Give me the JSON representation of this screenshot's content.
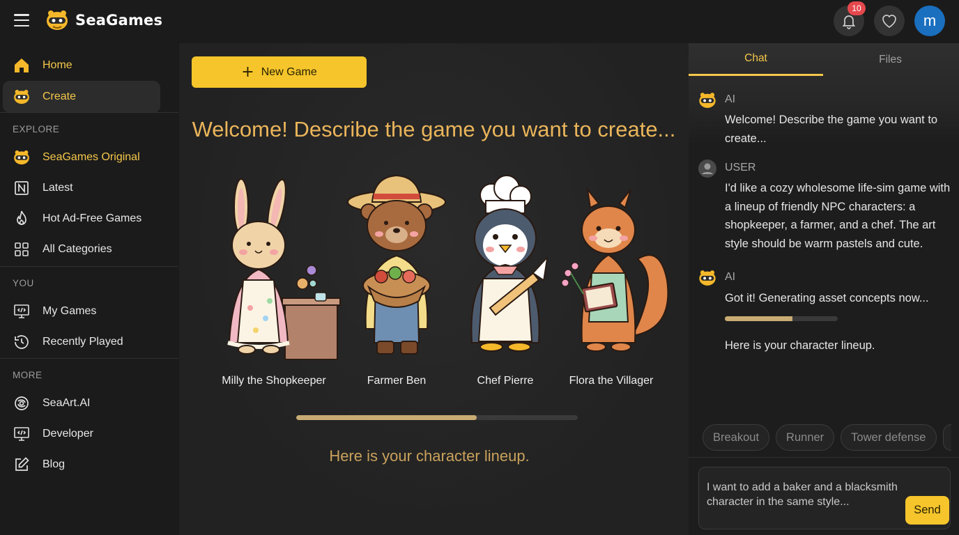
{
  "header": {
    "brand": "SeaGames",
    "notification_count": "10",
    "avatar_letter": "m"
  },
  "sidebar": {
    "items_top": [
      {
        "label": "Home",
        "icon": "home-icon"
      },
      {
        "label": "Create",
        "icon": "seagames-mascot-icon"
      }
    ],
    "explore_label": "EXPLORE",
    "explore_items": [
      {
        "label": "SeaGames Original",
        "icon": "seagames-mascot-icon"
      },
      {
        "label": "Latest",
        "icon": "new-badge-icon"
      },
      {
        "label": "Hot Ad-Free Games",
        "icon": "flame-icon"
      },
      {
        "label": "All Categories",
        "icon": "grid-icon"
      }
    ],
    "you_label": "YOU",
    "you_items": [
      {
        "label": "My Games",
        "icon": "code-monitor-icon"
      },
      {
        "label": "Recently Played",
        "icon": "history-icon"
      }
    ],
    "more_label": "MORE",
    "more_items": [
      {
        "label": "SeaArt.AI",
        "icon": "seaart-logo-icon"
      },
      {
        "label": "Developer",
        "icon": "code-monitor-icon"
      },
      {
        "label": "Blog",
        "icon": "edit-icon"
      }
    ]
  },
  "main": {
    "new_game_label": "New Game",
    "welcome": "Welcome! Describe the game you want to create...",
    "characters": [
      {
        "name": "Milly the Shopkeeper"
      },
      {
        "name": "Farmer Ben"
      },
      {
        "name": "Chef Pierre"
      },
      {
        "name": "Flora the Villager"
      }
    ],
    "progress": 0.64,
    "lineup_text": "Here is your character lineup."
  },
  "chat": {
    "tabs": [
      "Chat",
      "Files"
    ],
    "messages": [
      {
        "role": "AI",
        "text": "Welcome! Describe the game you want to create..."
      },
      {
        "role": "USER",
        "text": "I'd like a cozy wholesome life-sim game with a lineup of friendly NPC characters: a shopkeeper, a farmer, and a chef. The art style should be warm pastels and cute."
      },
      {
        "role": "AI",
        "text": "Got it! Generating asset concepts now..."
      }
    ],
    "generation_progress": 0.6,
    "followup_text": "Here is your character lineup.",
    "chips": [
      "Breakout",
      "Runner",
      "Tower defense"
    ],
    "input_value": "I want to add a baker and a blacksmith character in the same style...",
    "send_label": "Send"
  },
  "colors": {
    "accent": "#f5c52b",
    "accent_text": "#f5c84a",
    "heading": "#eab55a",
    "avatar": "#1a6fbf",
    "badge": "#e5484d"
  }
}
